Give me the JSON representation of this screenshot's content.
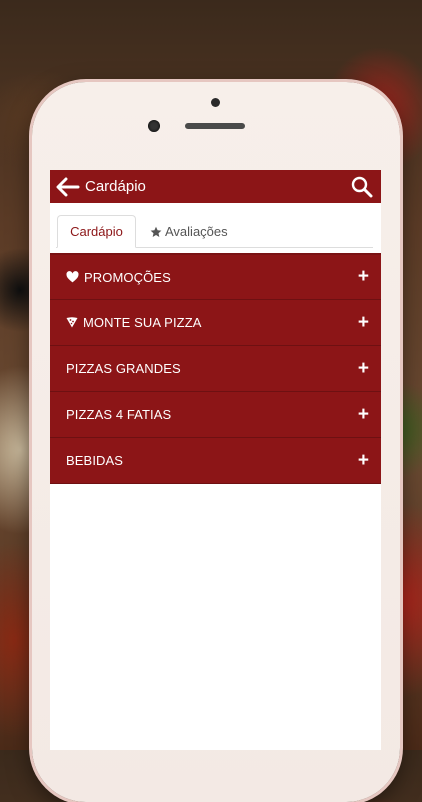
{
  "header": {
    "title": "Cardápio"
  },
  "tabs": [
    {
      "label": "Cardápio"
    },
    {
      "label": "Avaliações"
    }
  ],
  "menu": {
    "items": [
      {
        "label": "PROMOÇÕES",
        "icon": "heart-icon"
      },
      {
        "label": "MONTE SUA PIZZA",
        "icon": "pizza-slice-icon"
      },
      {
        "label": "PIZZAS GRANDES",
        "icon": ""
      },
      {
        "label": "PIZZAS 4 FATIAS",
        "icon": ""
      },
      {
        "label": "BEBIDAS",
        "icon": ""
      }
    ],
    "expand_symbol": "+"
  },
  "colors": {
    "primary": "#8c1517",
    "divider": "#6e1012",
    "text_light": "#ffffff"
  }
}
